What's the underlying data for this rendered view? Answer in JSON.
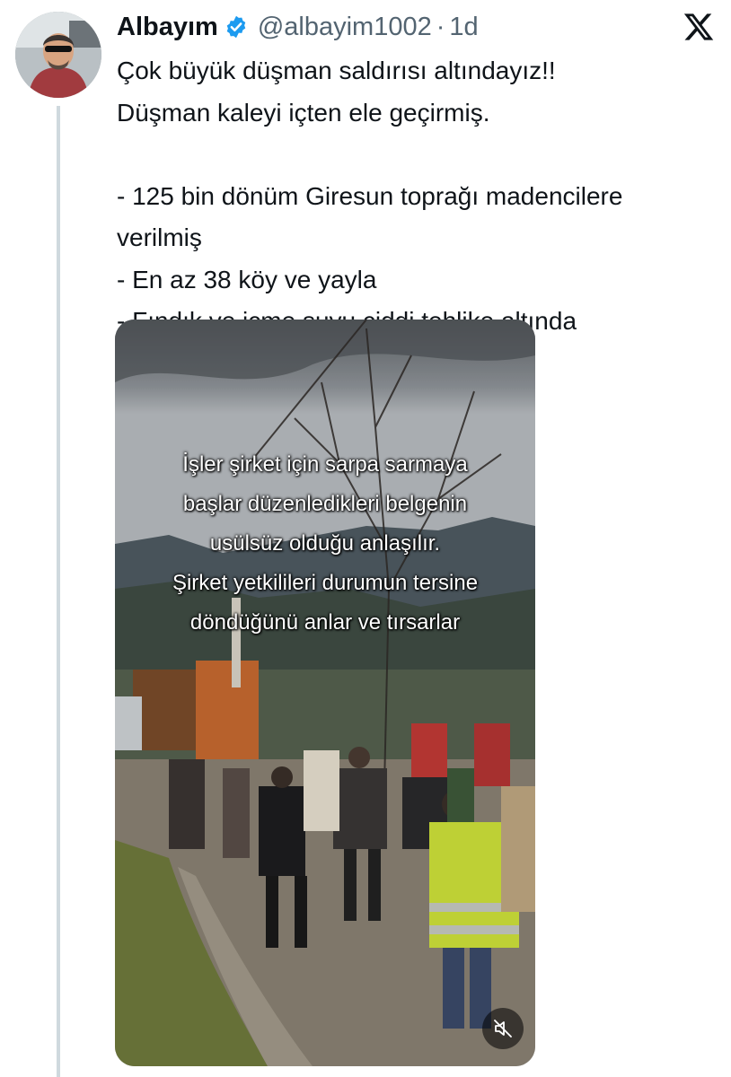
{
  "author": {
    "display_name": "Albayım",
    "handle": "@albayim1002",
    "separator": "·",
    "time": "1d",
    "verified_icon": "verified-badge-icon",
    "verified_color": "#1d9bf0"
  },
  "app": {
    "logo_icon": "x-logo-icon"
  },
  "tweet": {
    "lines": [
      "Çok büyük düşman saldırısı altındayız!!",
      "Düşman kaleyi içten ele geçirmiş.",
      "",
      "- 125 bin dönüm Giresun toprağı madencilere",
      "verilmiş",
      "- En az 38 köy ve yayla",
      "- Fındık ve içme suyu ciddi tehlike altında"
    ]
  },
  "media": {
    "caption_lines": [
      "İşler şirket için sarpa sarmaya",
      "başlar düzenledikleri belgenin",
      "usülsüz olduğu anlaşılır.",
      "Şirket yetkilileri durumun tersine",
      "döndüğünü anlar ve tırsarlar"
    ],
    "mute_icon": "speaker-muted-icon"
  }
}
